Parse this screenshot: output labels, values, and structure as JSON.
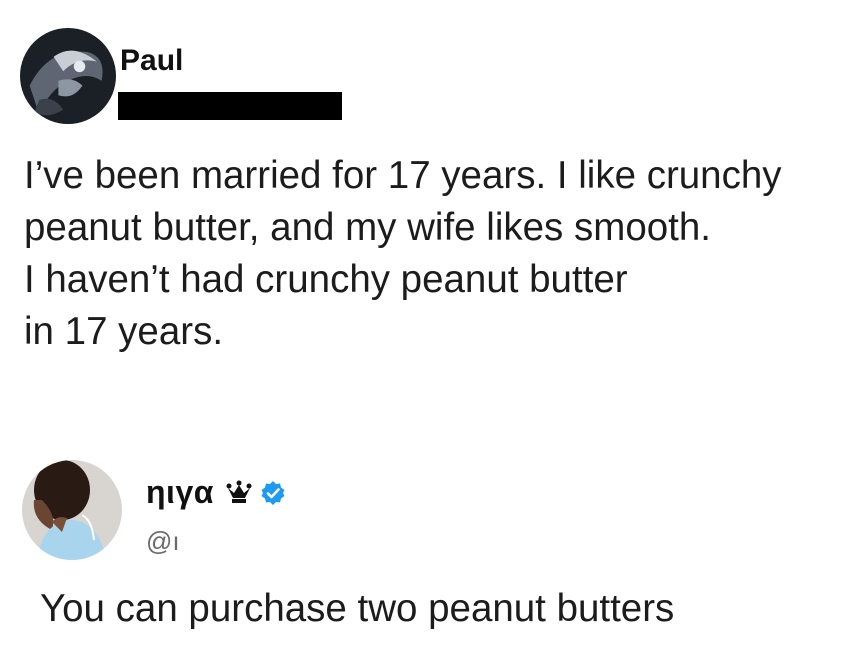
{
  "posts": [
    {
      "author": "Paul",
      "handle_redacted": true,
      "body_lines": [
        "I’ve been married for 17 years. I like crunchy",
        "peanut butter, and my wife likes smooth.",
        "I haven’t had crunchy peanut butter",
        "in 17 years."
      ]
    },
    {
      "author": "ηιγα",
      "handle": "@ı",
      "icons": [
        "crown-icon",
        "verified-icon"
      ],
      "verified_color": "#1d9bf0",
      "body": "You can purchase two peanut butters"
    }
  ]
}
